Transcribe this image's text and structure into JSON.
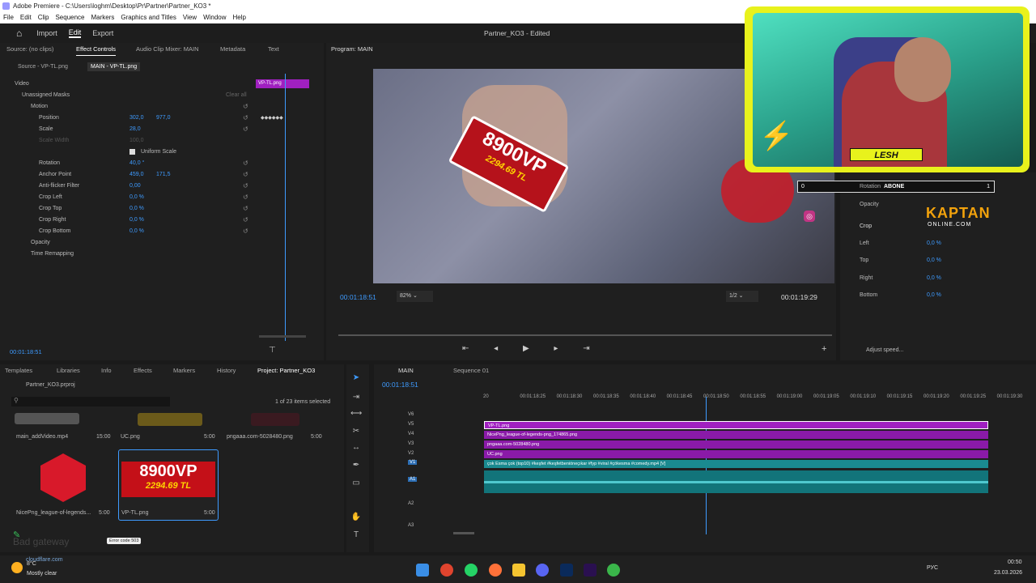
{
  "window": {
    "title": "Adobe Premiere - C:\\Users\\loghm\\Desktop\\Pr\\Partner\\Partner_KO3 *"
  },
  "menu": [
    "File",
    "Edit",
    "Clip",
    "Sequence",
    "Markers",
    "Graphics and Titles",
    "View",
    "Window",
    "Help"
  ],
  "workspaces": {
    "home": "home-icon",
    "import": "Import",
    "edit": "Edit",
    "export": "Export",
    "project_title": "Partner_KO3 - Edited"
  },
  "effect_panel": {
    "tabs": [
      "Source: (no clips)",
      "Effect Controls",
      "Audio Clip Mixer: MAIN",
      "Metadata",
      "Text"
    ],
    "source_label": "Source - VP-TL.png",
    "main_label": "MAIN - VP-TL.png",
    "clip_label": "VP-TL.png",
    "video_header": "Video",
    "masks": "Unassigned Masks",
    "clear_all": "Clear all",
    "motion": "Motion",
    "props": [
      {
        "name": "Position",
        "v1": "302,0",
        "v2": "977,0"
      },
      {
        "name": "Scale",
        "v1": "28,0",
        "v2": ""
      },
      {
        "name": "Scale Width",
        "v1": "100,0",
        "v2": ""
      },
      {
        "name": "Uniform Scale",
        "v1": "",
        "v2": ""
      },
      {
        "name": "Rotation",
        "v1": "40,0 °",
        "v2": ""
      },
      {
        "name": "Anchor Point",
        "v1": "459,0",
        "v2": "171,5"
      },
      {
        "name": "Anti-flicker Filter",
        "v1": "0,00",
        "v2": ""
      },
      {
        "name": "Crop Left",
        "v1": "0,0 %",
        "v2": ""
      },
      {
        "name": "Crop Top",
        "v1": "0,0 %",
        "v2": ""
      },
      {
        "name": "Crop Right",
        "v1": "0,0 %",
        "v2": ""
      },
      {
        "name": "Crop Bottom",
        "v1": "0,0 %",
        "v2": ""
      }
    ],
    "opacity": "Opacity",
    "time_remap": "Time Remapping",
    "timecode": "00:01:18:51"
  },
  "program": {
    "title": "Program: MAIN",
    "timecode": "00:01:18:51",
    "zoom": "82%",
    "res": "1/2",
    "duration": "00:01:19:29",
    "overlay_big": "8900VP",
    "overlay_small": "2294.69 TL"
  },
  "webcam": {
    "name": "LESH",
    "abone_left": "0",
    "abone_label": "ABONE",
    "abone_right": "1",
    "rotation_label": "Rotation",
    "brand_top": "KAPTAN",
    "brand_bottom": "ONLINE.COM"
  },
  "right_panel": {
    "opacity": "Opacity",
    "crop": "Crop",
    "left": "Left",
    "top": "Top",
    "right": "Right",
    "bottom": "Bottom",
    "val": "0,0 %",
    "adjust": "Adjust speed..."
  },
  "project": {
    "tabs": [
      "Templates",
      "Libraries",
      "Info",
      "Effects",
      "Markers",
      "History",
      "Project: Partner_KO3"
    ],
    "file": "Partner_KO3.prproj",
    "selected": "1 of 23 items selected",
    "items": [
      {
        "name": "main_addVideo.mp4",
        "dur": "15:00"
      },
      {
        "name": "UC.png",
        "dur": "5:00"
      },
      {
        "name": "pngaaa.com-5028480.png",
        "dur": "5:00"
      },
      {
        "name": "NicePng_league-of-legends...",
        "dur": "5:00"
      },
      {
        "name": "VP-TL.png",
        "dur": "5:00"
      }
    ],
    "error": "Error code 503",
    "cf1": "Bad gateway",
    "cf2": "cloudflare.com"
  },
  "timeline": {
    "tab1": "MAIN",
    "tab2": "Sequence 01",
    "timecode": "00:01:18:51",
    "ticks": [
      "20",
      "00:01:18:25",
      "00:01:18:30",
      "00:01:18:35",
      "00:01:18:40",
      "00:01:18:45",
      "00:01:18:50",
      "00:01:18:55",
      "00:01:19:00",
      "00:01:19:05",
      "00:01:19:10",
      "00:01:19:15",
      "00:01:19:20",
      "00:01:19:25",
      "00:01:19:30"
    ],
    "tracks": [
      "V6",
      "V5",
      "V4",
      "V3",
      "V2",
      "V1",
      "A1",
      "A2",
      "A3"
    ],
    "clips": [
      {
        "name": "VP-TL.png",
        "color": "#a020c0"
      },
      {
        "name": "NicePng_league-of-legends-png_174865.png",
        "color": "#8a1aa8"
      },
      {
        "name": "pngaaa.com-5028480.png",
        "color": "#8a1aa8"
      },
      {
        "name": "UC.png",
        "color": "#8a1aa8"
      },
      {
        "name": "çok Esma çok (top10) #keşfet #keşfetbeniöneçıkar #fyp #viral #çökesma #comedy.mp4 [V]",
        "color": "#1a8a90"
      }
    ]
  },
  "taskbar": {
    "weather_temp": "8°C",
    "weather_desc": "Mostly clear",
    "lang": "РУС",
    "time": "00:50",
    "date": "23.03.2026"
  },
  "colors": {
    "accent": "#3e9bff",
    "clip_purple": "#9b2fbf",
    "clip_teal": "#1f8d96",
    "webcam_yellow": "#e9f21f"
  }
}
